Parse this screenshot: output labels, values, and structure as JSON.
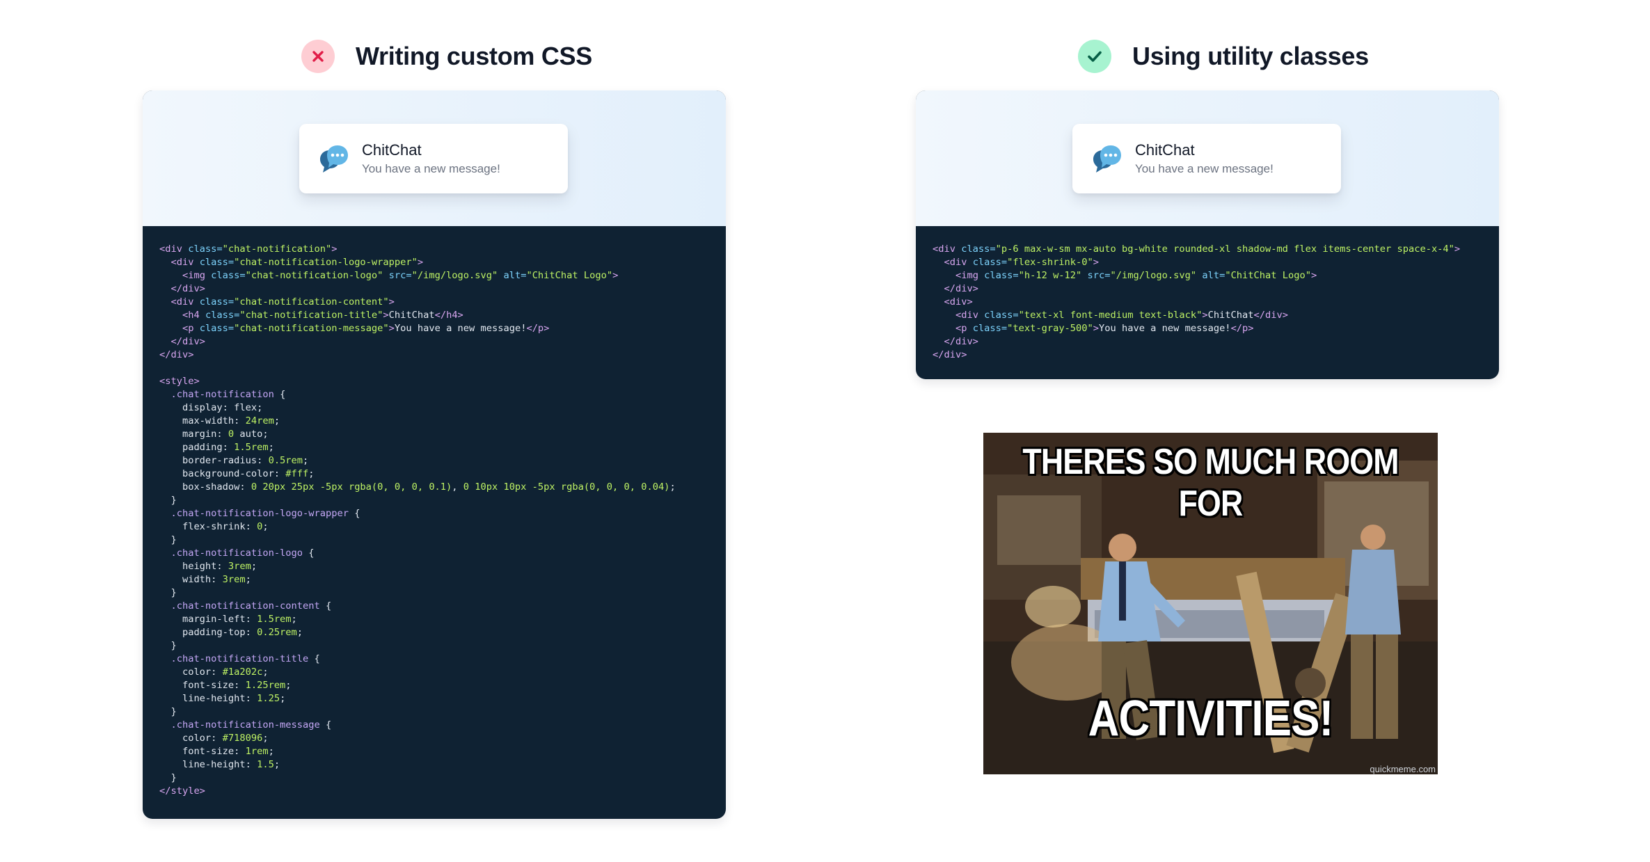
{
  "left": {
    "heading": "Writing custom CSS",
    "status_icon": "x-icon",
    "card": {
      "logo_icon": "chat-bubbles-icon",
      "title": "ChitChat",
      "message": "You have a new message!"
    },
    "code_lines": [
      [
        [
          "t",
          "<div "
        ],
        [
          "a",
          "class="
        ],
        [
          "s",
          "\"chat-notification\""
        ],
        [
          "t",
          ">"
        ]
      ],
      [
        [
          "p",
          "  "
        ],
        [
          "t",
          "<div "
        ],
        [
          "a",
          "class="
        ],
        [
          "s",
          "\"chat-notification-logo-wrapper\""
        ],
        [
          "t",
          ">"
        ]
      ],
      [
        [
          "p",
          "    "
        ],
        [
          "t",
          "<img "
        ],
        [
          "a",
          "class="
        ],
        [
          "s",
          "\"chat-notification-logo\""
        ],
        [
          "p",
          " "
        ],
        [
          "a",
          "src="
        ],
        [
          "s",
          "\"/img/logo.svg\""
        ],
        [
          "p",
          " "
        ],
        [
          "a",
          "alt="
        ],
        [
          "s",
          "\"ChitChat Logo\""
        ],
        [
          "t",
          ">"
        ]
      ],
      [
        [
          "p",
          "  "
        ],
        [
          "t",
          "</div>"
        ]
      ],
      [
        [
          "p",
          "  "
        ],
        [
          "t",
          "<div "
        ],
        [
          "a",
          "class="
        ],
        [
          "s",
          "\"chat-notification-content\""
        ],
        [
          "t",
          ">"
        ]
      ],
      [
        [
          "p",
          "    "
        ],
        [
          "t",
          "<h4 "
        ],
        [
          "a",
          "class="
        ],
        [
          "s",
          "\"chat-notification-title\""
        ],
        [
          "t",
          ">"
        ],
        [
          "p",
          "ChitChat"
        ],
        [
          "t",
          "</h4>"
        ]
      ],
      [
        [
          "p",
          "    "
        ],
        [
          "t",
          "<p "
        ],
        [
          "a",
          "class="
        ],
        [
          "s",
          "\"chat-notification-message\""
        ],
        [
          "t",
          ">"
        ],
        [
          "p",
          "You have a new message!"
        ],
        [
          "t",
          "</p>"
        ]
      ],
      [
        [
          "p",
          "  "
        ],
        [
          "t",
          "</div>"
        ]
      ],
      [
        [
          "t",
          "</div>"
        ]
      ],
      [],
      [
        [
          "t",
          "<style>"
        ]
      ],
      [
        [
          "p",
          "  "
        ],
        [
          "sel",
          ".chat-notification"
        ],
        [
          "p",
          " {"
        ]
      ],
      [
        [
          "p",
          "    display: flex;"
        ]
      ],
      [
        [
          "p",
          "    max-width: "
        ],
        [
          "n",
          "24rem"
        ],
        [
          "p",
          ";"
        ]
      ],
      [
        [
          "p",
          "    margin: "
        ],
        [
          "n",
          "0"
        ],
        [
          "p",
          " auto;"
        ]
      ],
      [
        [
          "p",
          "    padding: "
        ],
        [
          "n",
          "1.5rem"
        ],
        [
          "p",
          ";"
        ]
      ],
      [
        [
          "p",
          "    border-radius: "
        ],
        [
          "n",
          "0.5rem"
        ],
        [
          "p",
          ";"
        ]
      ],
      [
        [
          "p",
          "    background-color: "
        ],
        [
          "n",
          "#fff"
        ],
        [
          "p",
          ";"
        ]
      ],
      [
        [
          "p",
          "    box-shadow: "
        ],
        [
          "n",
          "0 20px 25px -5px rgba(0, 0, 0, 0.1)"
        ],
        [
          "p",
          ", "
        ],
        [
          "n",
          "0 10px 10px -5px rgba(0, 0, 0, 0.04)"
        ],
        [
          "p",
          ";"
        ]
      ],
      [
        [
          "p",
          "  }"
        ]
      ],
      [
        [
          "p",
          "  "
        ],
        [
          "sel",
          ".chat-notification-logo-wrapper"
        ],
        [
          "p",
          " {"
        ]
      ],
      [
        [
          "p",
          "    flex-shrink: "
        ],
        [
          "n",
          "0"
        ],
        [
          "p",
          ";"
        ]
      ],
      [
        [
          "p",
          "  }"
        ]
      ],
      [
        [
          "p",
          "  "
        ],
        [
          "sel",
          ".chat-notification-logo"
        ],
        [
          "p",
          " {"
        ]
      ],
      [
        [
          "p",
          "    height: "
        ],
        [
          "n",
          "3rem"
        ],
        [
          "p",
          ";"
        ]
      ],
      [
        [
          "p",
          "    width: "
        ],
        [
          "n",
          "3rem"
        ],
        [
          "p",
          ";"
        ]
      ],
      [
        [
          "p",
          "  }"
        ]
      ],
      [
        [
          "p",
          "  "
        ],
        [
          "sel",
          ".chat-notification-content"
        ],
        [
          "p",
          " {"
        ]
      ],
      [
        [
          "p",
          "    margin-left: "
        ],
        [
          "n",
          "1.5rem"
        ],
        [
          "p",
          ";"
        ]
      ],
      [
        [
          "p",
          "    padding-top: "
        ],
        [
          "n",
          "0.25rem"
        ],
        [
          "p",
          ";"
        ]
      ],
      [
        [
          "p",
          "  }"
        ]
      ],
      [
        [
          "p",
          "  "
        ],
        [
          "sel",
          ".chat-notification-title"
        ],
        [
          "p",
          " {"
        ]
      ],
      [
        [
          "p",
          "    color: "
        ],
        [
          "n",
          "#1a202c"
        ],
        [
          "p",
          ";"
        ]
      ],
      [
        [
          "p",
          "    font-size: "
        ],
        [
          "n",
          "1.25rem"
        ],
        [
          "p",
          ";"
        ]
      ],
      [
        [
          "p",
          "    line-height: "
        ],
        [
          "n",
          "1.25"
        ],
        [
          "p",
          ";"
        ]
      ],
      [
        [
          "p",
          "  }"
        ]
      ],
      [
        [
          "p",
          "  "
        ],
        [
          "sel",
          ".chat-notification-message"
        ],
        [
          "p",
          " {"
        ]
      ],
      [
        [
          "p",
          "    color: "
        ],
        [
          "n",
          "#718096"
        ],
        [
          "p",
          ";"
        ]
      ],
      [
        [
          "p",
          "    font-size: "
        ],
        [
          "n",
          "1rem"
        ],
        [
          "p",
          ";"
        ]
      ],
      [
        [
          "p",
          "    line-height: "
        ],
        [
          "n",
          "1.5"
        ],
        [
          "p",
          ";"
        ]
      ],
      [
        [
          "p",
          "  }"
        ]
      ],
      [
        [
          "t",
          "</style>"
        ]
      ]
    ]
  },
  "right": {
    "heading": "Using utility classes",
    "status_icon": "checkmark-icon",
    "card": {
      "logo_icon": "chat-bubbles-icon",
      "title": "ChitChat",
      "message": "You have a new message!"
    },
    "code_lines": [
      [
        [
          "t",
          "<div "
        ],
        [
          "a",
          "class="
        ],
        [
          "s",
          "\"p-6 max-w-sm mx-auto bg-white rounded-xl shadow-md flex items-center space-x-4\""
        ],
        [
          "t",
          ">"
        ]
      ],
      [
        [
          "p",
          "  "
        ],
        [
          "t",
          "<div "
        ],
        [
          "a",
          "class="
        ],
        [
          "s",
          "\"flex-shrink-0\""
        ],
        [
          "t",
          ">"
        ]
      ],
      [
        [
          "p",
          "    "
        ],
        [
          "t",
          "<img "
        ],
        [
          "a",
          "class="
        ],
        [
          "s",
          "\"h-12 w-12\""
        ],
        [
          "p",
          " "
        ],
        [
          "a",
          "src="
        ],
        [
          "s",
          "\"/img/logo.svg\""
        ],
        [
          "p",
          " "
        ],
        [
          "a",
          "alt="
        ],
        [
          "s",
          "\"ChitChat Logo\""
        ],
        [
          "t",
          ">"
        ]
      ],
      [
        [
          "p",
          "  "
        ],
        [
          "t",
          "</div>"
        ]
      ],
      [
        [
          "p",
          "  "
        ],
        [
          "t",
          "<div>"
        ]
      ],
      [
        [
          "p",
          "    "
        ],
        [
          "t",
          "<div "
        ],
        [
          "a",
          "class="
        ],
        [
          "s",
          "\"text-xl font-medium text-black\""
        ],
        [
          "t",
          ">"
        ],
        [
          "p",
          "ChitChat"
        ],
        [
          "t",
          "</div>"
        ]
      ],
      [
        [
          "p",
          "    "
        ],
        [
          "t",
          "<p "
        ],
        [
          "a",
          "class="
        ],
        [
          "s",
          "\"text-gray-500\""
        ],
        [
          "t",
          ">"
        ],
        [
          "p",
          "You have a new message!"
        ],
        [
          "t",
          "</p>"
        ]
      ],
      [
        [
          "p",
          "  "
        ],
        [
          "t",
          "</div>"
        ]
      ],
      [
        [
          "t",
          "</div>"
        ]
      ]
    ]
  },
  "meme": {
    "top_text": "THERES SO MUCH ROOM FOR",
    "bottom_text": "ACTIVITIES!",
    "credit": "quickmeme.com"
  },
  "colors": {
    "code_bg": "#0f2233",
    "tag": "#d8a6f0",
    "attr": "#7dd3fc",
    "string": "#bef264",
    "selector": "#c4a7f5",
    "x_badge": "#fecdd3",
    "x_mark": "#e11d48",
    "check_badge": "#a7f3d0",
    "check_mark": "#065f46"
  }
}
